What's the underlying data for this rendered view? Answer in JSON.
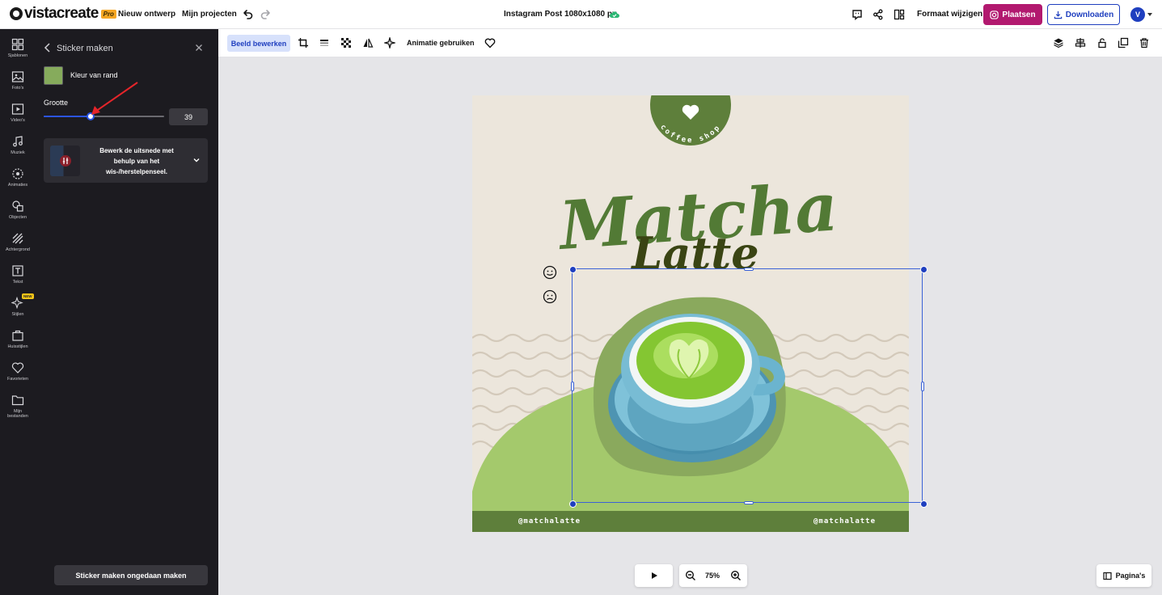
{
  "app": {
    "logo_text": "vistacreate",
    "pro_badge": "Pro",
    "nav": {
      "new_design": "Nieuw ontwerp",
      "my_projects": "Mijn projecten"
    },
    "doc_title": "Instagram Post 1080x1080 px",
    "format_button": "Formaat wijzigen",
    "publish_button": "Plaatsen",
    "download_button": "Downloaden",
    "avatar_initial": "V"
  },
  "rail": {
    "items": [
      {
        "label": "Sjablonen",
        "icon": "templates-icon"
      },
      {
        "label": "Foto's",
        "icon": "photo-icon"
      },
      {
        "label": "Video's",
        "icon": "video-icon"
      },
      {
        "label": "Muziek",
        "icon": "music-icon"
      },
      {
        "label": "Animaties",
        "icon": "animation-icon"
      },
      {
        "label": "Objecten",
        "icon": "objects-icon"
      },
      {
        "label": "Achtergrond",
        "icon": "background-icon"
      },
      {
        "label": "Tekst",
        "icon": "text-icon"
      },
      {
        "label": "Stijlen",
        "icon": "styles-icon",
        "badge": "NEW"
      },
      {
        "label": "Huisstijlen",
        "icon": "brand-kit-icon"
      },
      {
        "label": "Favorieten",
        "icon": "heart-icon"
      },
      {
        "label": "Mijn bestanden",
        "icon": "folder-icon"
      }
    ]
  },
  "panel": {
    "title": "Sticker maken",
    "border_color_label": "Kleur van rand",
    "border_color": "#86ab5c",
    "size_label": "Grootte",
    "size_value": "39",
    "slider_fraction": 0.39,
    "tip_text": "Bewerk de uitsnede met behulp van het wis-/herstelpenseel.",
    "undo_button": "Sticker maken ongedaan maken"
  },
  "context_toolbar": {
    "edit_image": "Beeld bewerken",
    "use_animation": "Animatie gebruiken"
  },
  "design": {
    "badge_text": "coffee shop",
    "title_line1": "Matcha",
    "title_line2": "Latte",
    "handle_left": "@matchalatte",
    "handle_right": "@matchalatte",
    "colors": {
      "background": "#ece6dc",
      "dark_green": "#5e7f3b",
      "light_green": "#a4c96c",
      "title_green": "#527a35",
      "latte_dark": "#3a4413"
    }
  },
  "bottom": {
    "zoom": "75%",
    "pages_button": "Pagina's"
  }
}
